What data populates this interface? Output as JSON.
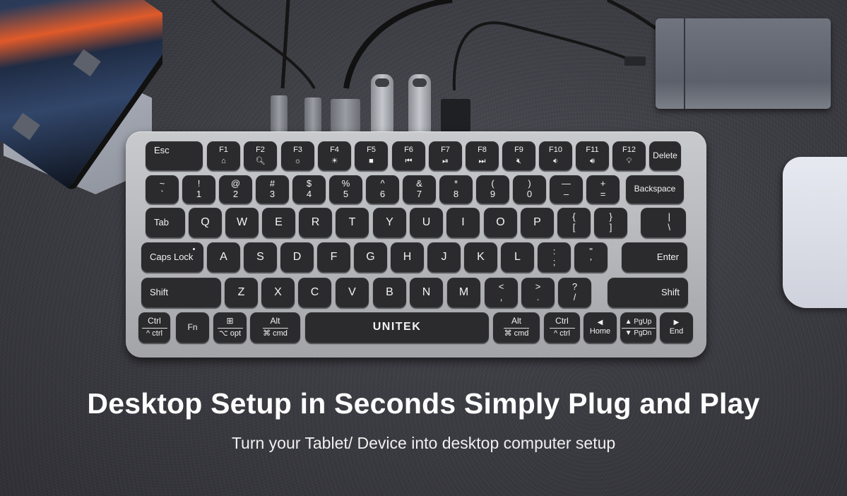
{
  "headline": "Desktop Setup in Seconds Simply Plug and Play",
  "subheadline": "Turn your Tablet/ Device into desktop computer setup",
  "keyboard": {
    "brand": "UNITEK",
    "row_function": [
      {
        "label": "Esc"
      },
      {
        "label": "F1",
        "icon": "⌂"
      },
      {
        "label": "F2",
        "icon": "🔍︎"
      },
      {
        "label": "F3",
        "icon": "☼"
      },
      {
        "label": "F4",
        "icon": "☀"
      },
      {
        "label": "F5",
        "icon": "■"
      },
      {
        "label": "F6",
        "icon": "⏮"
      },
      {
        "label": "F7",
        "icon": "⏯"
      },
      {
        "label": "F8",
        "icon": "⏭"
      },
      {
        "label": "F9",
        "icon": "🔇︎"
      },
      {
        "label": "F10",
        "icon": "🔉︎"
      },
      {
        "label": "F11",
        "icon": "🔊︎"
      },
      {
        "label": "F12",
        "icon": "💡︎"
      },
      {
        "label": "Delete"
      }
    ],
    "row_number": [
      {
        "top": "~",
        "bot": "`"
      },
      {
        "top": "!",
        "bot": "1"
      },
      {
        "top": "@",
        "bot": "2"
      },
      {
        "top": "#",
        "bot": "3"
      },
      {
        "top": "$",
        "bot": "4"
      },
      {
        "top": "%",
        "bot": "5"
      },
      {
        "top": "^",
        "bot": "6"
      },
      {
        "top": "&",
        "bot": "7"
      },
      {
        "top": "*",
        "bot": "8"
      },
      {
        "top": "(",
        "bot": "9"
      },
      {
        "top": ")",
        "bot": "0"
      },
      {
        "top": "—",
        "bot": "–"
      },
      {
        "top": "+",
        "bot": "="
      },
      {
        "label": "Backspace"
      }
    ],
    "row_qwerty": [
      {
        "label": "Tab"
      },
      {
        "label": "Q"
      },
      {
        "label": "W"
      },
      {
        "label": "E"
      },
      {
        "label": "R"
      },
      {
        "label": "T"
      },
      {
        "label": "Y"
      },
      {
        "label": "U"
      },
      {
        "label": "I"
      },
      {
        "label": "O"
      },
      {
        "label": "P"
      },
      {
        "top": "{",
        "bot": "["
      },
      {
        "top": "}",
        "bot": "]"
      },
      {
        "top": "|",
        "bot": "\\"
      }
    ],
    "row_home": [
      {
        "label": "Caps Lock"
      },
      {
        "label": "A"
      },
      {
        "label": "S"
      },
      {
        "label": "D"
      },
      {
        "label": "F"
      },
      {
        "label": "G"
      },
      {
        "label": "H"
      },
      {
        "label": "J"
      },
      {
        "label": "K"
      },
      {
        "label": "L"
      },
      {
        "top": ":",
        "bot": ";"
      },
      {
        "top": "\"",
        "bot": "'"
      },
      {
        "label": "Enter"
      }
    ],
    "row_shift": [
      {
        "label": "Shift"
      },
      {
        "label": "Z"
      },
      {
        "label": "X"
      },
      {
        "label": "C"
      },
      {
        "label": "V"
      },
      {
        "label": "B"
      },
      {
        "label": "N"
      },
      {
        "label": "M"
      },
      {
        "top": "<",
        "bot": ","
      },
      {
        "top": ">",
        "bot": "."
      },
      {
        "top": "?",
        "bot": "/"
      },
      {
        "label": "Shift"
      }
    ],
    "row_bottom": [
      {
        "top": "Ctrl",
        "bot": "^ ctrl"
      },
      {
        "label": "Fn"
      },
      {
        "top": "⊞",
        "bot": "⌥ opt"
      },
      {
        "top": "Alt",
        "bot": "⌘ cmd"
      },
      {
        "label": "UNITEK"
      },
      {
        "top": "Alt",
        "bot": "⌘ cmd"
      },
      {
        "top": "Ctrl",
        "bot": "^ ctrl"
      },
      {
        "top": "◀",
        "bot": "Home"
      },
      {
        "top": "▲ PgUp",
        "bot": "▼ PgDn"
      },
      {
        "top": "▶",
        "bot": "End"
      }
    ]
  }
}
